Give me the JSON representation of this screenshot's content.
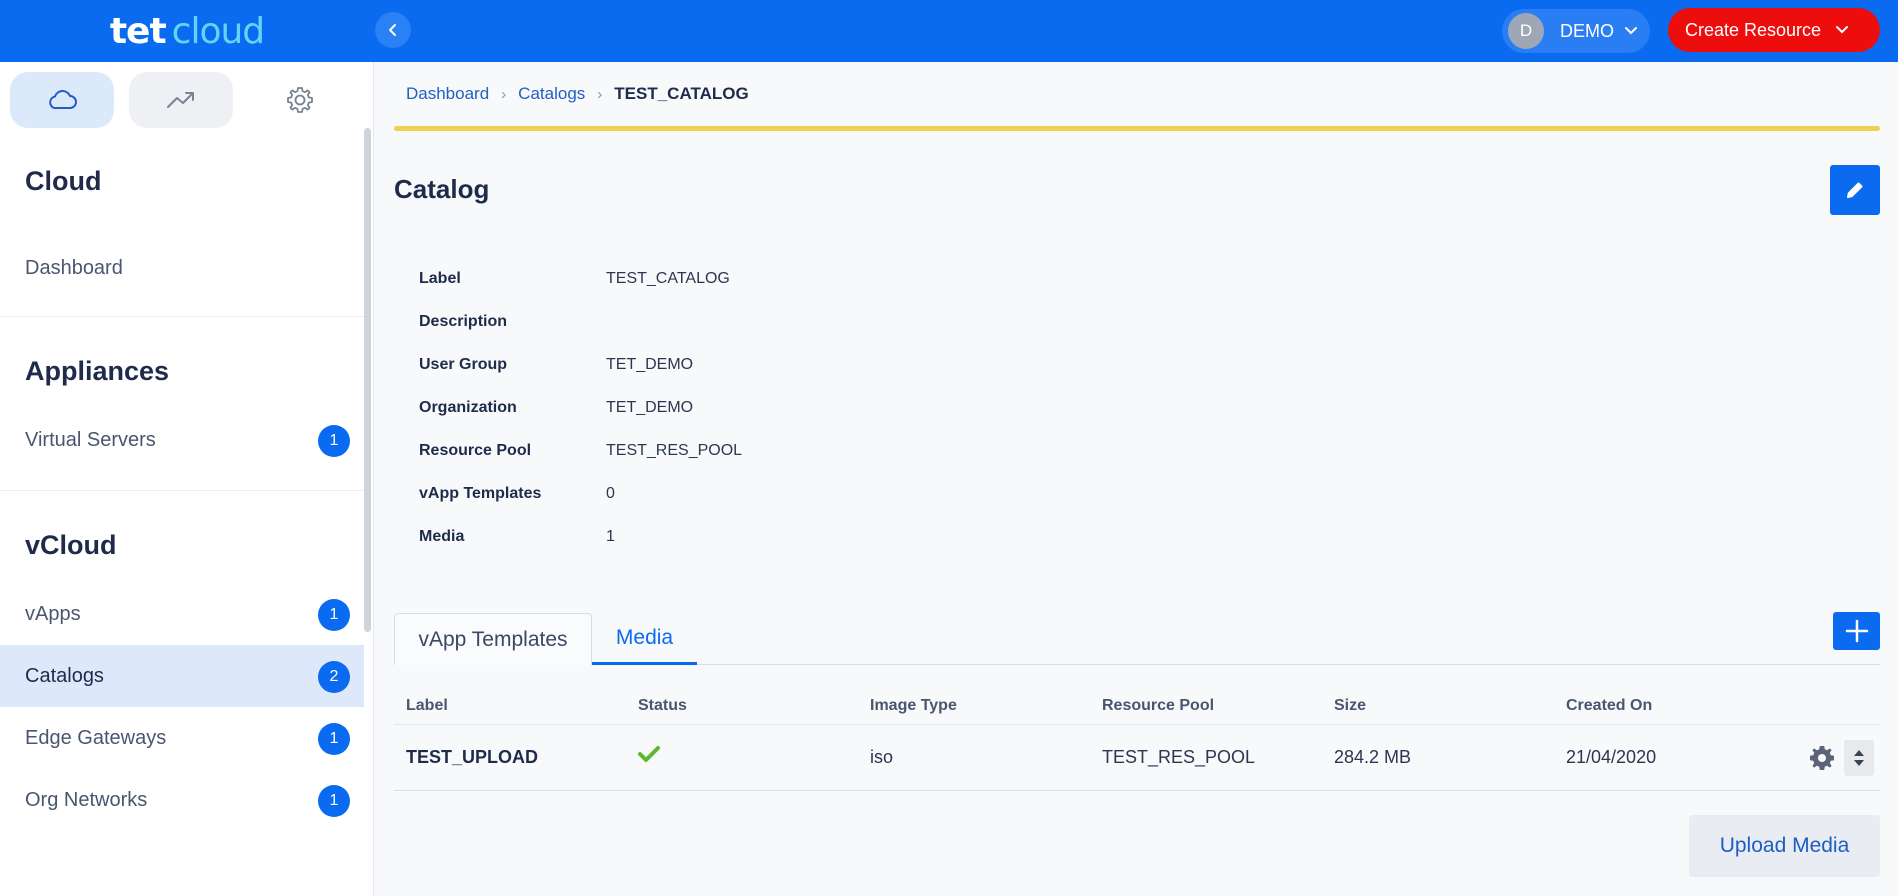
{
  "colors": {
    "brand": "#0a6bf0",
    "create": "#ee0d0d",
    "accent_line": "#f1cf52",
    "ok": "#5db82e"
  },
  "header": {
    "logo_primary": "tet",
    "logo_secondary": "cloud",
    "user_initial": "D",
    "user_name": "DEMO",
    "create_label": "Create Resource"
  },
  "sidebar": {
    "tabs": [
      "cloud-icon",
      "trending-icon",
      "gear-icon"
    ],
    "cloud_title": "Cloud",
    "dashboard": "Dashboard",
    "appliances_title": "Appliances",
    "virtual_servers": {
      "label": "Virtual Servers",
      "count": "1"
    },
    "vcloud_title": "vCloud",
    "items": [
      {
        "label": "vApps",
        "count": "1"
      },
      {
        "label": "Catalogs",
        "count": "2"
      },
      {
        "label": "Edge Gateways",
        "count": "1"
      },
      {
        "label": "Org Networks",
        "count": "1"
      }
    ]
  },
  "breadcrumb": {
    "dashboard": "Dashboard",
    "catalogs": "Catalogs",
    "current": "TEST_CATALOG"
  },
  "page": {
    "title": "Catalog"
  },
  "details": [
    {
      "label": "Label",
      "value": "TEST_CATALOG"
    },
    {
      "label": "Description",
      "value": ""
    },
    {
      "label": "User Group",
      "value": "TET_DEMO"
    },
    {
      "label": "Organization",
      "value": "TET_DEMO"
    },
    {
      "label": "Resource Pool",
      "value": "TEST_RES_POOL"
    },
    {
      "label": "vApp Templates",
      "value": "0"
    },
    {
      "label": "Media",
      "value": "1"
    }
  ],
  "tabs": {
    "templates": "vApp Templates",
    "media": "Media"
  },
  "table": {
    "headers": [
      "Label",
      "Status",
      "Image Type",
      "Resource Pool",
      "Size",
      "Created On"
    ],
    "rows": [
      {
        "label": "TEST_UPLOAD",
        "status": "ok",
        "image_type": "iso",
        "resource_pool": "TEST_RES_POOL",
        "size": "284.2 MB",
        "created_on": "21/04/2020"
      }
    ]
  },
  "upload_label": "Upload Media"
}
